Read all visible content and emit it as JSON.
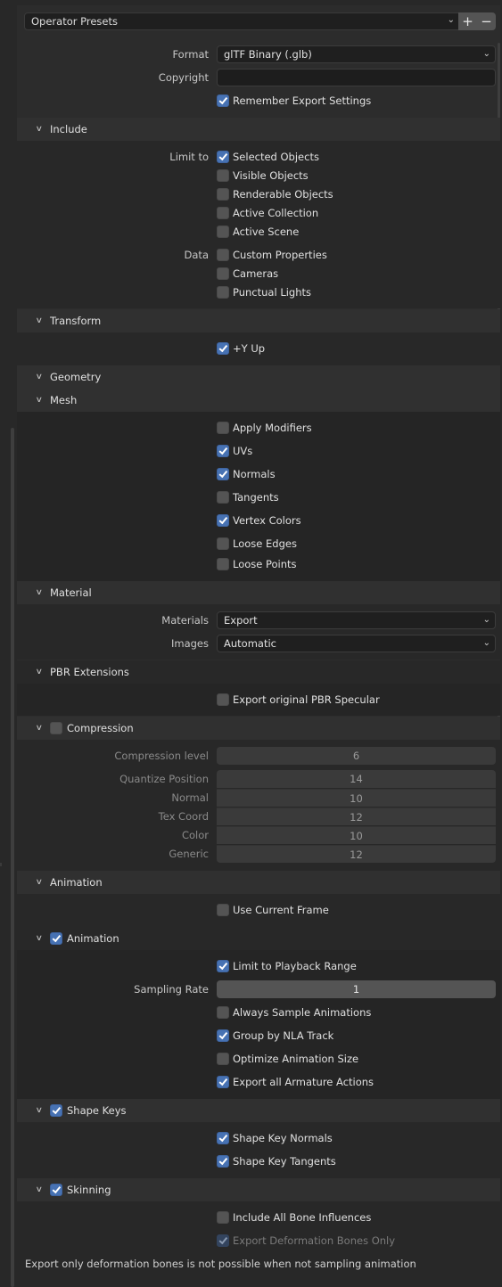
{
  "presets": {
    "label": "Operator Presets",
    "add_label": "+",
    "remove_label": "−"
  },
  "general": {
    "format_label": "Format",
    "format_value": "glTF Binary (.glb)",
    "copyright_label": "Copyright",
    "copyright_value": "",
    "remember_label": "Remember Export Settings",
    "remember_checked": true
  },
  "include": {
    "title": "Include",
    "limit_to_label": "Limit to",
    "limit_to": [
      {
        "label": "Selected Objects",
        "checked": true
      },
      {
        "label": "Visible Objects",
        "checked": false
      },
      {
        "label": "Renderable Objects",
        "checked": false
      },
      {
        "label": "Active Collection",
        "checked": false
      },
      {
        "label": "Active Scene",
        "checked": false
      }
    ],
    "data_label": "Data",
    "data": [
      {
        "label": "Custom Properties",
        "checked": false
      },
      {
        "label": "Cameras",
        "checked": false
      },
      {
        "label": "Punctual Lights",
        "checked": false
      }
    ]
  },
  "transform": {
    "title": "Transform",
    "y_up_label": "+Y Up",
    "y_up_checked": true
  },
  "geometry": {
    "title": "Geometry",
    "mesh_title": "Mesh",
    "mesh_options": [
      {
        "label": "Apply Modifiers",
        "checked": false
      },
      {
        "label": "UVs",
        "checked": true
      },
      {
        "label": "Normals",
        "checked": true
      },
      {
        "label": "Tangents",
        "checked": false
      },
      {
        "label": "Vertex Colors",
        "checked": true
      },
      {
        "label": "Loose Edges",
        "checked": false
      },
      {
        "label": "Loose Points",
        "checked": false
      }
    ],
    "material_title": "Material",
    "materials_label": "Materials",
    "materials_value": "Export",
    "images_label": "Images",
    "images_value": "Automatic",
    "pbr_title": "PBR Extensions",
    "pbr_specular_label": "Export original PBR Specular",
    "pbr_specular_checked": false,
    "compression_title": "Compression",
    "compression_enabled": false,
    "compression_level_label": "Compression level",
    "compression_level_value": "6",
    "quantize": [
      {
        "label": "Quantize Position",
        "value": "14"
      },
      {
        "label": "Normal",
        "value": "10"
      },
      {
        "label": "Tex Coord",
        "value": "12"
      },
      {
        "label": "Color",
        "value": "10"
      },
      {
        "label": "Generic",
        "value": "12"
      }
    ]
  },
  "animation": {
    "title": "Animation",
    "use_current_frame_label": "Use Current Frame",
    "use_current_frame_checked": false,
    "sub_title": "Animation",
    "sub_enabled": true,
    "limit_playback_label": "Limit to Playback Range",
    "limit_playback_checked": true,
    "sampling_rate_label": "Sampling Rate",
    "sampling_rate_value": "1",
    "options": [
      {
        "label": "Always Sample Animations",
        "checked": false
      },
      {
        "label": "Group by NLA Track",
        "checked": true
      },
      {
        "label": "Optimize Animation Size",
        "checked": false
      },
      {
        "label": "Export all Armature Actions",
        "checked": true
      }
    ],
    "shape_keys_title": "Shape Keys",
    "shape_keys_enabled": true,
    "shape_key_options": [
      {
        "label": "Shape Key Normals",
        "checked": true
      },
      {
        "label": "Shape Key Tangents",
        "checked": true
      }
    ],
    "skinning_title": "Skinning",
    "skinning_enabled": true,
    "include_all_bone_label": "Include All Bone Influences",
    "include_all_bone_checked": false,
    "deform_bones_label": "Export Deformation Bones Only",
    "deform_bones_checked": true,
    "deform_bones_disabled": true,
    "info_message": "Export only deformation bones is not possible when not sampling animation"
  }
}
